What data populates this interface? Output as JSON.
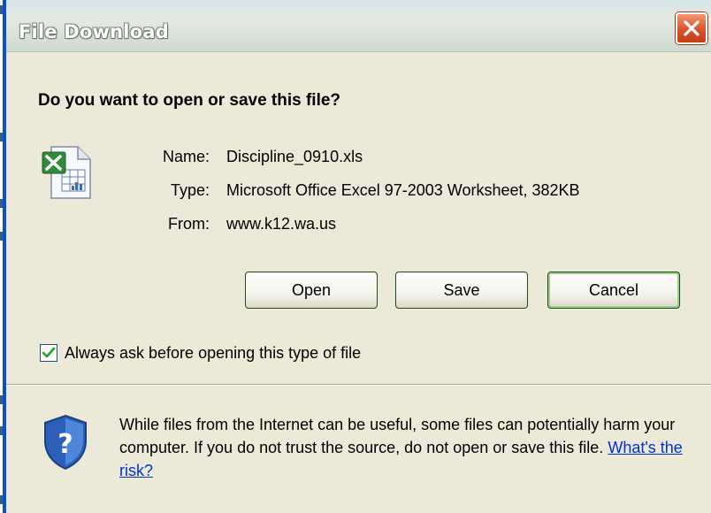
{
  "window": {
    "title": "File Download",
    "close_icon": "close-icon"
  },
  "prompt": {
    "question": "Do you want to open or save this file?"
  },
  "file": {
    "icon": "excel-file-icon",
    "name_label": "Name:",
    "name": "Discipline_0910.xls",
    "type_label": "Type:",
    "type": "Microsoft Office Excel 97-2003 Worksheet, 382KB",
    "from_label": "From:",
    "from": "www.k12.wa.us"
  },
  "buttons": {
    "open": "Open",
    "save": "Save",
    "cancel": "Cancel"
  },
  "checkbox": {
    "label": "Always ask before opening this type of file",
    "checked": true
  },
  "warning": {
    "icon": "security-shield-icon",
    "text": "While files from the Internet can be useful, some files can potentially harm your computer. If you do not trust the source, do not open or save this file.",
    "link": "What's the risk?"
  },
  "colors": {
    "dialog_bg": "#ece9d8",
    "titlebar": "#d7e6e7",
    "close_button": "#d8532a",
    "link": "#0033cc"
  }
}
